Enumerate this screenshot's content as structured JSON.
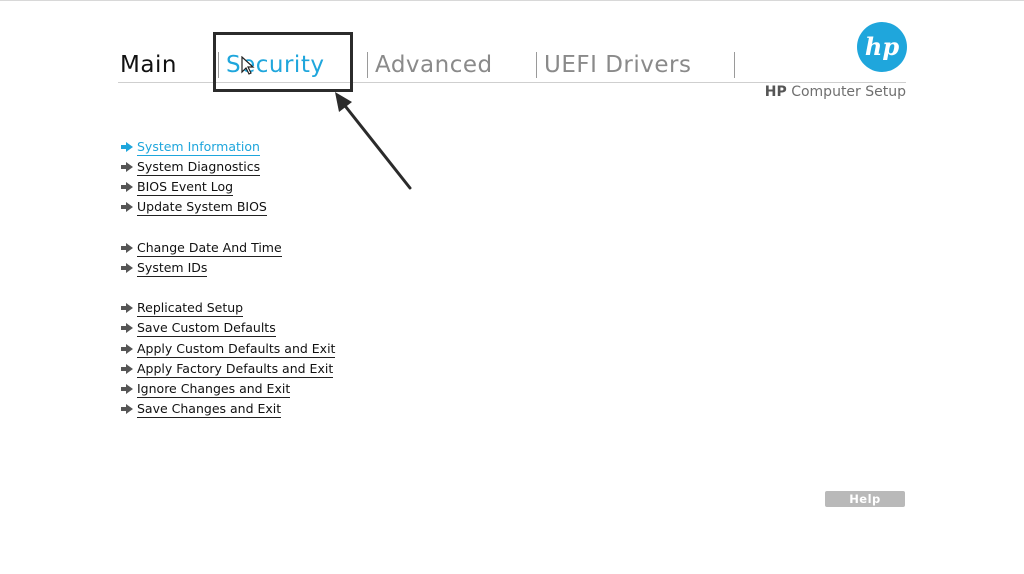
{
  "tabs": [
    {
      "label": "Main"
    },
    {
      "label": "Security"
    },
    {
      "label": "Advanced"
    },
    {
      "label": "UEFI Drivers"
    }
  ],
  "active_tab": "Security",
  "header": {
    "logo_text": "hp",
    "setup_brand": "HP",
    "setup_title": "Computer Setup"
  },
  "menu": {
    "group1": [
      {
        "label": "System Information"
      },
      {
        "label": "System Diagnostics"
      },
      {
        "label": "BIOS Event Log"
      },
      {
        "label": "Update System BIOS"
      }
    ],
    "group2": [
      {
        "label": "Change Date And Time"
      },
      {
        "label": "System IDs"
      }
    ],
    "group3": [
      {
        "label": "Replicated Setup"
      },
      {
        "label": "Save Custom Defaults"
      },
      {
        "label": "Apply Custom Defaults and Exit"
      },
      {
        "label": "Apply Factory Defaults and Exit"
      },
      {
        "label": "Ignore Changes and Exit"
      },
      {
        "label": "Save Changes and Exit"
      }
    ]
  },
  "help_button": {
    "label": "Help"
  },
  "colors": {
    "accent": "#1fa6dc",
    "text": "#111111",
    "tab_inactive": "#8a8a8a",
    "help_bg": "#b9b9b9"
  },
  "icons": [
    "arrow-right-icon",
    "mouse-cursor-icon",
    "annotation-arrow-icon",
    "hp-logo"
  ]
}
